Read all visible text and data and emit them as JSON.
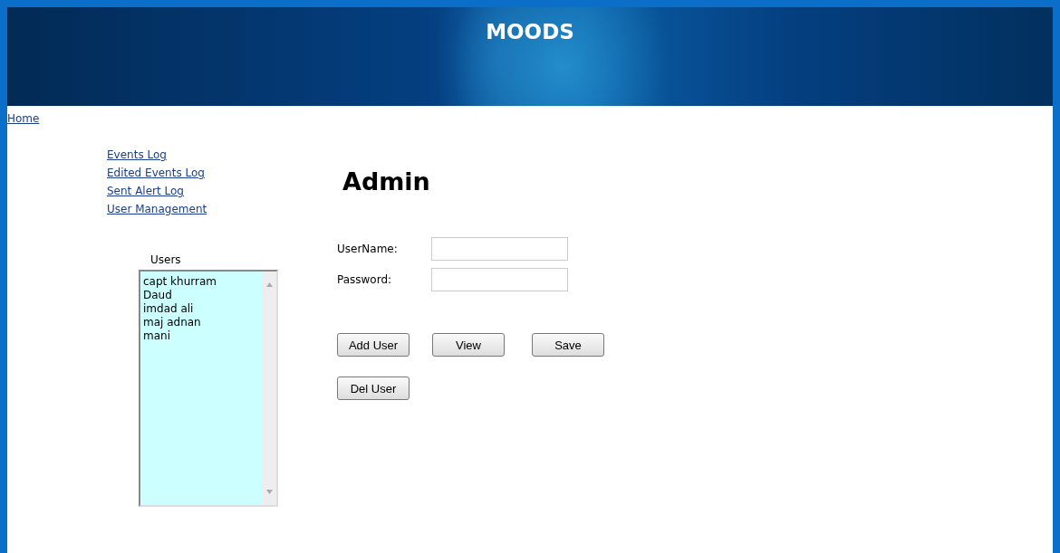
{
  "header": {
    "title": "MOODS"
  },
  "breadcrumb": {
    "home": "Home"
  },
  "sidebar": {
    "links": [
      "Events Log",
      "Edited Events Log",
      "Sent Alert Log",
      "User Management"
    ]
  },
  "users": {
    "label": "Users",
    "items": [
      "capt khurram",
      "Daud",
      "imdad ali",
      "maj adnan",
      "mani"
    ]
  },
  "admin": {
    "heading": "Admin",
    "fields": [
      {
        "label": "UserName:"
      },
      {
        "label": "Password:"
      }
    ],
    "button_rows": [
      [
        "Add User",
        "View",
        "Save"
      ],
      [
        "Del User"
      ]
    ]
  }
}
